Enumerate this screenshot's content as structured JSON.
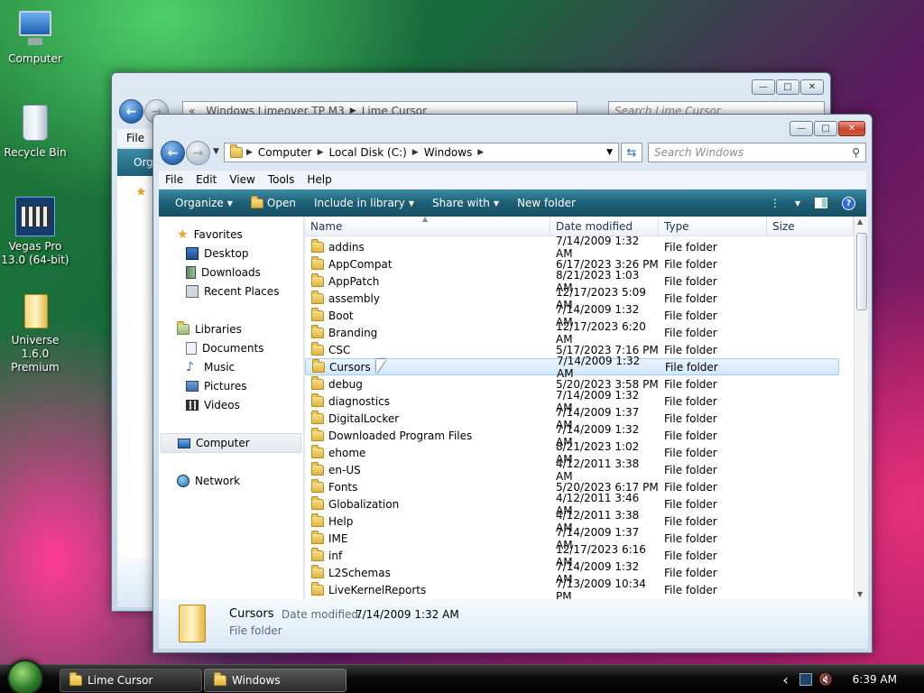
{
  "desktop": {
    "icons": [
      {
        "label": "Computer"
      },
      {
        "label": "Recycle Bin"
      },
      {
        "label": "Vegas Pro 13.0 (64-bit)"
      },
      {
        "label": "Universe 1.6.0 Premium"
      }
    ]
  },
  "back_window": {
    "breadcrumb": [
      "«",
      "Windows Limeover TP M3",
      "Lime Cursor"
    ],
    "search_placeholder": "Search Lime Cursor",
    "menu_file": "File",
    "org": "Org"
  },
  "front_window": {
    "breadcrumb": [
      "Computer",
      "Local Disk (C:)",
      "Windows"
    ],
    "search_placeholder": "Search Windows",
    "menu": [
      "File",
      "Edit",
      "View",
      "Tools",
      "Help"
    ],
    "commands": {
      "organize": "Organize",
      "open": "Open",
      "include": "Include in library",
      "share": "Share with",
      "newfolder": "New folder"
    },
    "nav": {
      "favorites": "Favorites",
      "desktop": "Desktop",
      "downloads": "Downloads",
      "recent": "Recent Places",
      "libraries": "Libraries",
      "documents": "Documents",
      "music": "Music",
      "pictures": "Pictures",
      "videos": "Videos",
      "computer": "Computer",
      "network": "Network"
    },
    "columns": {
      "name": "Name",
      "date": "Date modified",
      "type": "Type",
      "size": "Size"
    },
    "files": [
      {
        "name": "addins",
        "date": "7/14/2009 1:32 AM",
        "type": "File folder"
      },
      {
        "name": "AppCompat",
        "date": "6/17/2023 3:26 PM",
        "type": "File folder"
      },
      {
        "name": "AppPatch",
        "date": "8/21/2023 1:03 AM",
        "type": "File folder"
      },
      {
        "name": "assembly",
        "date": "12/17/2023 5:09 AM",
        "type": "File folder"
      },
      {
        "name": "Boot",
        "date": "7/14/2009 1:32 AM",
        "type": "File folder"
      },
      {
        "name": "Branding",
        "date": "12/17/2023 6:20 AM",
        "type": "File folder"
      },
      {
        "name": "CSC",
        "date": "5/17/2023 7:16 PM",
        "type": "File folder"
      },
      {
        "name": "Cursors",
        "date": "7/14/2009 1:32 AM",
        "type": "File folder"
      },
      {
        "name": "debug",
        "date": "5/20/2023 3:58 PM",
        "type": "File folder"
      },
      {
        "name": "diagnostics",
        "date": "7/14/2009 1:32 AM",
        "type": "File folder"
      },
      {
        "name": "DigitalLocker",
        "date": "7/14/2009 1:37 AM",
        "type": "File folder"
      },
      {
        "name": "Downloaded Program Files",
        "date": "7/14/2009 1:32 AM",
        "type": "File folder"
      },
      {
        "name": "ehome",
        "date": "8/21/2023 1:02 AM",
        "type": "File folder"
      },
      {
        "name": "en-US",
        "date": "4/12/2011 3:38 AM",
        "type": "File folder"
      },
      {
        "name": "Fonts",
        "date": "5/20/2023 6:17 PM",
        "type": "File folder"
      },
      {
        "name": "Globalization",
        "date": "4/12/2011 3:46 AM",
        "type": "File folder"
      },
      {
        "name": "Help",
        "date": "4/12/2011 3:38 AM",
        "type": "File folder"
      },
      {
        "name": "IME",
        "date": "7/14/2009 1:37 AM",
        "type": "File folder"
      },
      {
        "name": "inf",
        "date": "12/17/2023 6:16 AM",
        "type": "File folder"
      },
      {
        "name": "L2Schemas",
        "date": "7/14/2009 1:32 AM",
        "type": "File folder"
      },
      {
        "name": "LiveKernelReports",
        "date": "7/13/2009 10:34 PM",
        "type": "File folder"
      }
    ],
    "details": {
      "name": "Cursors",
      "date_label": "Date modified:",
      "date_value": "7/14/2009 1:32 AM",
      "type": "File folder"
    }
  },
  "taskbar": {
    "buttons": [
      "Lime Cursor",
      "Windows"
    ],
    "clock": "6:39 AM",
    "tray_chevron": "‹"
  }
}
